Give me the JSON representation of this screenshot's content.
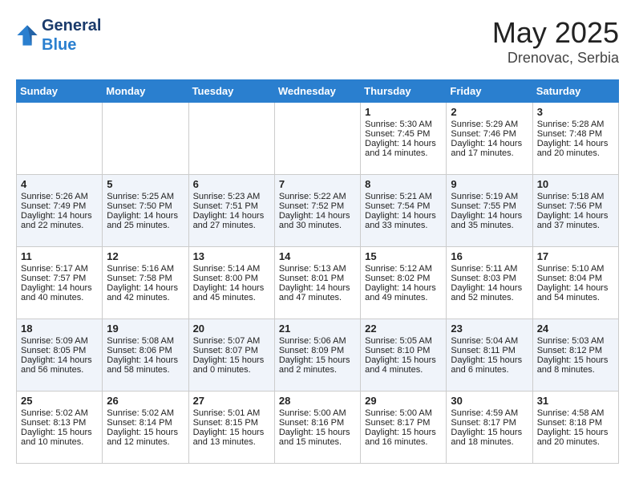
{
  "header": {
    "logo_line1": "General",
    "logo_line2": "Blue",
    "title": "May 2025",
    "subtitle": "Drenovac, Serbia"
  },
  "weekdays": [
    "Sunday",
    "Monday",
    "Tuesday",
    "Wednesday",
    "Thursday",
    "Friday",
    "Saturday"
  ],
  "weeks": [
    [
      {
        "day": "",
        "content": ""
      },
      {
        "day": "",
        "content": ""
      },
      {
        "day": "",
        "content": ""
      },
      {
        "day": "",
        "content": ""
      },
      {
        "day": "1",
        "content": "Sunrise: 5:30 AM\nSunset: 7:45 PM\nDaylight: 14 hours\nand 14 minutes."
      },
      {
        "day": "2",
        "content": "Sunrise: 5:29 AM\nSunset: 7:46 PM\nDaylight: 14 hours\nand 17 minutes."
      },
      {
        "day": "3",
        "content": "Sunrise: 5:28 AM\nSunset: 7:48 PM\nDaylight: 14 hours\nand 20 minutes."
      }
    ],
    [
      {
        "day": "4",
        "content": "Sunrise: 5:26 AM\nSunset: 7:49 PM\nDaylight: 14 hours\nand 22 minutes."
      },
      {
        "day": "5",
        "content": "Sunrise: 5:25 AM\nSunset: 7:50 PM\nDaylight: 14 hours\nand 25 minutes."
      },
      {
        "day": "6",
        "content": "Sunrise: 5:23 AM\nSunset: 7:51 PM\nDaylight: 14 hours\nand 27 minutes."
      },
      {
        "day": "7",
        "content": "Sunrise: 5:22 AM\nSunset: 7:52 PM\nDaylight: 14 hours\nand 30 minutes."
      },
      {
        "day": "8",
        "content": "Sunrise: 5:21 AM\nSunset: 7:54 PM\nDaylight: 14 hours\nand 33 minutes."
      },
      {
        "day": "9",
        "content": "Sunrise: 5:19 AM\nSunset: 7:55 PM\nDaylight: 14 hours\nand 35 minutes."
      },
      {
        "day": "10",
        "content": "Sunrise: 5:18 AM\nSunset: 7:56 PM\nDaylight: 14 hours\nand 37 minutes."
      }
    ],
    [
      {
        "day": "11",
        "content": "Sunrise: 5:17 AM\nSunset: 7:57 PM\nDaylight: 14 hours\nand 40 minutes."
      },
      {
        "day": "12",
        "content": "Sunrise: 5:16 AM\nSunset: 7:58 PM\nDaylight: 14 hours\nand 42 minutes."
      },
      {
        "day": "13",
        "content": "Sunrise: 5:14 AM\nSunset: 8:00 PM\nDaylight: 14 hours\nand 45 minutes."
      },
      {
        "day": "14",
        "content": "Sunrise: 5:13 AM\nSunset: 8:01 PM\nDaylight: 14 hours\nand 47 minutes."
      },
      {
        "day": "15",
        "content": "Sunrise: 5:12 AM\nSunset: 8:02 PM\nDaylight: 14 hours\nand 49 minutes."
      },
      {
        "day": "16",
        "content": "Sunrise: 5:11 AM\nSunset: 8:03 PM\nDaylight: 14 hours\nand 52 minutes."
      },
      {
        "day": "17",
        "content": "Sunrise: 5:10 AM\nSunset: 8:04 PM\nDaylight: 14 hours\nand 54 minutes."
      }
    ],
    [
      {
        "day": "18",
        "content": "Sunrise: 5:09 AM\nSunset: 8:05 PM\nDaylight: 14 hours\nand 56 minutes."
      },
      {
        "day": "19",
        "content": "Sunrise: 5:08 AM\nSunset: 8:06 PM\nDaylight: 14 hours\nand 58 minutes."
      },
      {
        "day": "20",
        "content": "Sunrise: 5:07 AM\nSunset: 8:07 PM\nDaylight: 15 hours\nand 0 minutes."
      },
      {
        "day": "21",
        "content": "Sunrise: 5:06 AM\nSunset: 8:09 PM\nDaylight: 15 hours\nand 2 minutes."
      },
      {
        "day": "22",
        "content": "Sunrise: 5:05 AM\nSunset: 8:10 PM\nDaylight: 15 hours\nand 4 minutes."
      },
      {
        "day": "23",
        "content": "Sunrise: 5:04 AM\nSunset: 8:11 PM\nDaylight: 15 hours\nand 6 minutes."
      },
      {
        "day": "24",
        "content": "Sunrise: 5:03 AM\nSunset: 8:12 PM\nDaylight: 15 hours\nand 8 minutes."
      }
    ],
    [
      {
        "day": "25",
        "content": "Sunrise: 5:02 AM\nSunset: 8:13 PM\nDaylight: 15 hours\nand 10 minutes."
      },
      {
        "day": "26",
        "content": "Sunrise: 5:02 AM\nSunset: 8:14 PM\nDaylight: 15 hours\nand 12 minutes."
      },
      {
        "day": "27",
        "content": "Sunrise: 5:01 AM\nSunset: 8:15 PM\nDaylight: 15 hours\nand 13 minutes."
      },
      {
        "day": "28",
        "content": "Sunrise: 5:00 AM\nSunset: 8:16 PM\nDaylight: 15 hours\nand 15 minutes."
      },
      {
        "day": "29",
        "content": "Sunrise: 5:00 AM\nSunset: 8:17 PM\nDaylight: 15 hours\nand 16 minutes."
      },
      {
        "day": "30",
        "content": "Sunrise: 4:59 AM\nSunset: 8:17 PM\nDaylight: 15 hours\nand 18 minutes."
      },
      {
        "day": "31",
        "content": "Sunrise: 4:58 AM\nSunset: 8:18 PM\nDaylight: 15 hours\nand 20 minutes."
      }
    ]
  ]
}
